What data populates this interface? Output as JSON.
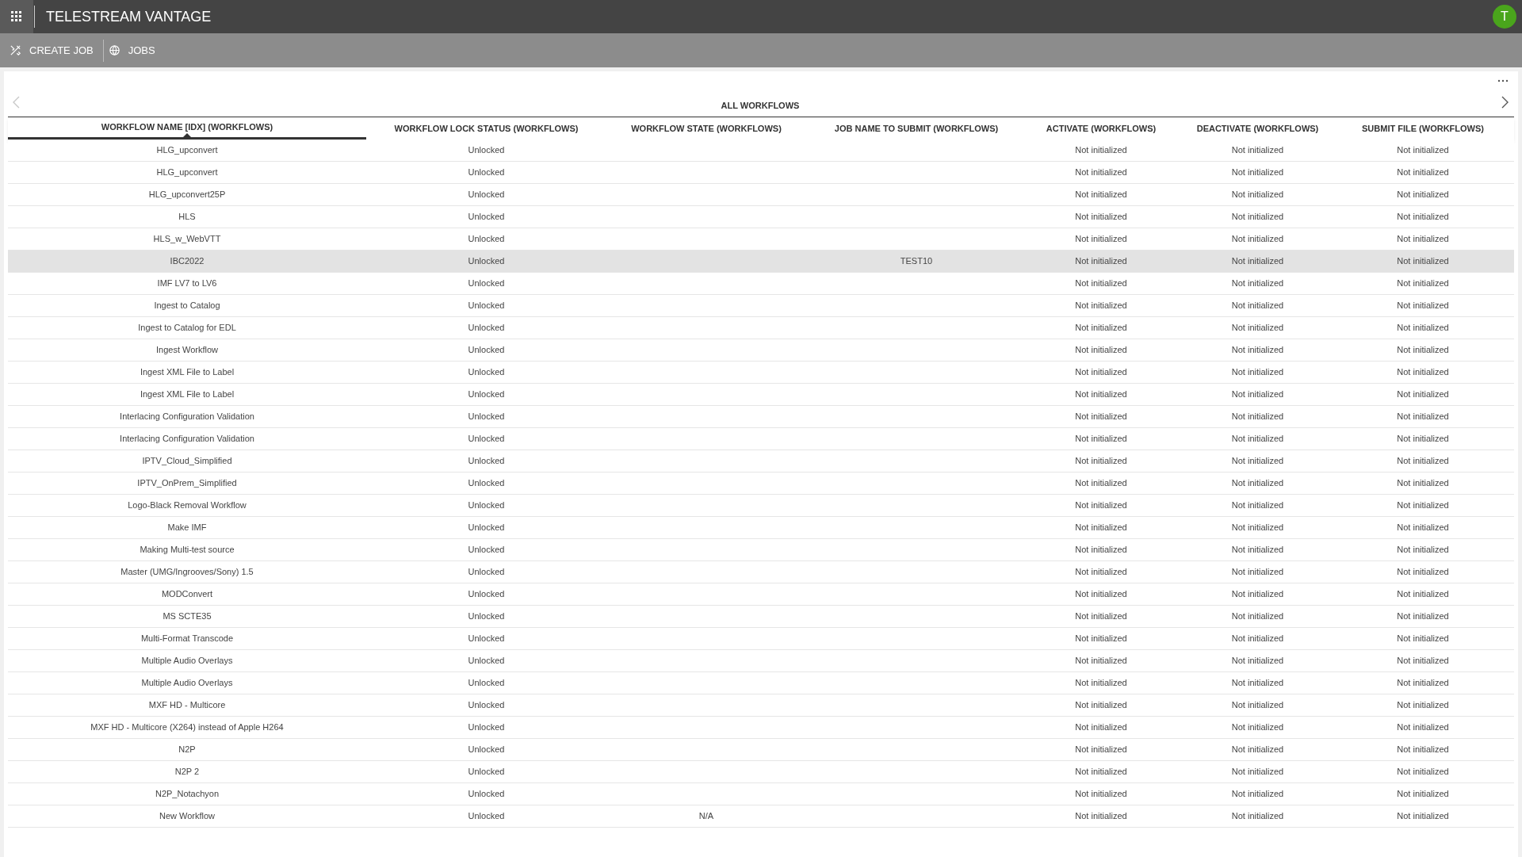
{
  "app": {
    "title": "TELESTREAM VANTAGE",
    "avatar": "T"
  },
  "toolbar": [
    {
      "kind": "create",
      "label": "CREATE JOB"
    },
    {
      "kind": "jobs",
      "label": "JOBS"
    }
  ],
  "panel": {
    "title": "ALL WORKFLOWS",
    "prev_disabled": true,
    "next_disabled": false
  },
  "columns": [
    {
      "label": "WORKFLOW NAME [IDX] (WORKFLOWS)",
      "sorted": true
    },
    {
      "label": "WORKFLOW LOCK STATUS (WORKFLOWS)",
      "sorted": false
    },
    {
      "label": "WORKFLOW STATE (WORKFLOWS)",
      "sorted": false
    },
    {
      "label": "JOB NAME TO SUBMIT (WORKFLOWS)",
      "sorted": false
    },
    {
      "label": "ACTIVATE (WORKFLOWS)",
      "sorted": false
    },
    {
      "label": "DEACTIVATE (WORKFLOWS)",
      "sorted": false
    },
    {
      "label": "SUBMIT FILE (WORKFLOWS)",
      "sorted": false
    }
  ],
  "rows": [
    {
      "cells": [
        "HLG_upconvert",
        "Unlocked",
        null,
        null,
        "Not initialized",
        "Not initialized",
        "Not initialized"
      ],
      "selected": false
    },
    {
      "cells": [
        "HLG_upconvert",
        "Unlocked",
        null,
        null,
        "Not initialized",
        "Not initialized",
        "Not initialized"
      ],
      "selected": false
    },
    {
      "cells": [
        "HLG_upconvert25P",
        "Unlocked",
        null,
        null,
        "Not initialized",
        "Not initialized",
        "Not initialized"
      ],
      "selected": false
    },
    {
      "cells": [
        "HLS",
        "Unlocked",
        null,
        null,
        "Not initialized",
        "Not initialized",
        "Not initialized"
      ],
      "selected": false
    },
    {
      "cells": [
        "HLS_w_WebVTT",
        "Unlocked",
        null,
        null,
        "Not initialized",
        "Not initialized",
        "Not initialized"
      ],
      "selected": false
    },
    {
      "cells": [
        "IBC2022",
        "Unlocked",
        null,
        "TEST10",
        "Not initialized",
        "Not initialized",
        "Not initialized"
      ],
      "selected": true
    },
    {
      "cells": [
        "IMF LV7 to LV6",
        "Unlocked",
        null,
        null,
        "Not initialized",
        "Not initialized",
        "Not initialized"
      ],
      "selected": false
    },
    {
      "cells": [
        "Ingest to Catalog",
        "Unlocked",
        null,
        null,
        "Not initialized",
        "Not initialized",
        "Not initialized"
      ],
      "selected": false
    },
    {
      "cells": [
        "Ingest to Catalog for EDL",
        "Unlocked",
        null,
        null,
        "Not initialized",
        "Not initialized",
        "Not initialized"
      ],
      "selected": false
    },
    {
      "cells": [
        "Ingest Workflow",
        "Unlocked",
        null,
        null,
        "Not initialized",
        "Not initialized",
        "Not initialized"
      ],
      "selected": false
    },
    {
      "cells": [
        "Ingest XML File to Label",
        "Unlocked",
        null,
        null,
        "Not initialized",
        "Not initialized",
        "Not initialized"
      ],
      "selected": false
    },
    {
      "cells": [
        "Ingest XML File to Label",
        "Unlocked",
        null,
        null,
        "Not initialized",
        "Not initialized",
        "Not initialized"
      ],
      "selected": false
    },
    {
      "cells": [
        "Interlacing Configuration Validation",
        "Unlocked",
        null,
        null,
        "Not initialized",
        "Not initialized",
        "Not initialized"
      ],
      "selected": false
    },
    {
      "cells": [
        "Interlacing Configuration Validation",
        "Unlocked",
        null,
        null,
        "Not initialized",
        "Not initialized",
        "Not initialized"
      ],
      "selected": false
    },
    {
      "cells": [
        "IPTV_Cloud_Simplified",
        "Unlocked",
        null,
        null,
        "Not initialized",
        "Not initialized",
        "Not initialized"
      ],
      "selected": false
    },
    {
      "cells": [
        "IPTV_OnPrem_Simplified",
        "Unlocked",
        null,
        null,
        "Not initialized",
        "Not initialized",
        "Not initialized"
      ],
      "selected": false
    },
    {
      "cells": [
        "Logo-Black Removal Workflow",
        "Unlocked",
        null,
        null,
        "Not initialized",
        "Not initialized",
        "Not initialized"
      ],
      "selected": false
    },
    {
      "cells": [
        "Make IMF",
        "Unlocked",
        null,
        null,
        "Not initialized",
        "Not initialized",
        "Not initialized"
      ],
      "selected": false
    },
    {
      "cells": [
        "Making Multi-test source",
        "Unlocked",
        null,
        null,
        "Not initialized",
        "Not initialized",
        "Not initialized"
      ],
      "selected": false
    },
    {
      "cells": [
        "Master (UMG/Ingrooves/Sony) 1.5",
        "Unlocked",
        null,
        null,
        "Not initialized",
        "Not initialized",
        "Not initialized"
      ],
      "selected": false
    },
    {
      "cells": [
        "MODConvert",
        "Unlocked",
        null,
        null,
        "Not initialized",
        "Not initialized",
        "Not initialized"
      ],
      "selected": false
    },
    {
      "cells": [
        "MS SCTE35",
        "Unlocked",
        null,
        null,
        "Not initialized",
        "Not initialized",
        "Not initialized"
      ],
      "selected": false
    },
    {
      "cells": [
        "Multi-Format Transcode",
        "Unlocked",
        null,
        null,
        "Not initialized",
        "Not initialized",
        "Not initialized"
      ],
      "selected": false
    },
    {
      "cells": [
        "Multiple Audio Overlays",
        "Unlocked",
        null,
        null,
        "Not initialized",
        "Not initialized",
        "Not initialized"
      ],
      "selected": false
    },
    {
      "cells": [
        "Multiple Audio Overlays",
        "Unlocked",
        null,
        null,
        "Not initialized",
        "Not initialized",
        "Not initialized"
      ],
      "selected": false
    },
    {
      "cells": [
        "MXF HD - Multicore",
        "Unlocked",
        null,
        null,
        "Not initialized",
        "Not initialized",
        "Not initialized"
      ],
      "selected": false
    },
    {
      "cells": [
        "MXF HD - Multicore (X264) instead of Apple H264",
        "Unlocked",
        null,
        null,
        "Not initialized",
        "Not initialized",
        "Not initialized"
      ],
      "selected": false
    },
    {
      "cells": [
        "N2P",
        "Unlocked",
        null,
        null,
        "Not initialized",
        "Not initialized",
        "Not initialized"
      ],
      "selected": false
    },
    {
      "cells": [
        "N2P 2",
        "Unlocked",
        null,
        null,
        "Not initialized",
        "Not initialized",
        "Not initialized"
      ],
      "selected": false
    },
    {
      "cells": [
        "N2P_Notachyon",
        "Unlocked",
        null,
        null,
        "Not initialized",
        "Not initialized",
        "Not initialized"
      ],
      "selected": false
    },
    {
      "cells": [
        "New Workflow",
        "Unlocked",
        "N/A",
        null,
        "Not initialized",
        "Not initialized",
        "Not initialized"
      ],
      "selected": false
    }
  ]
}
